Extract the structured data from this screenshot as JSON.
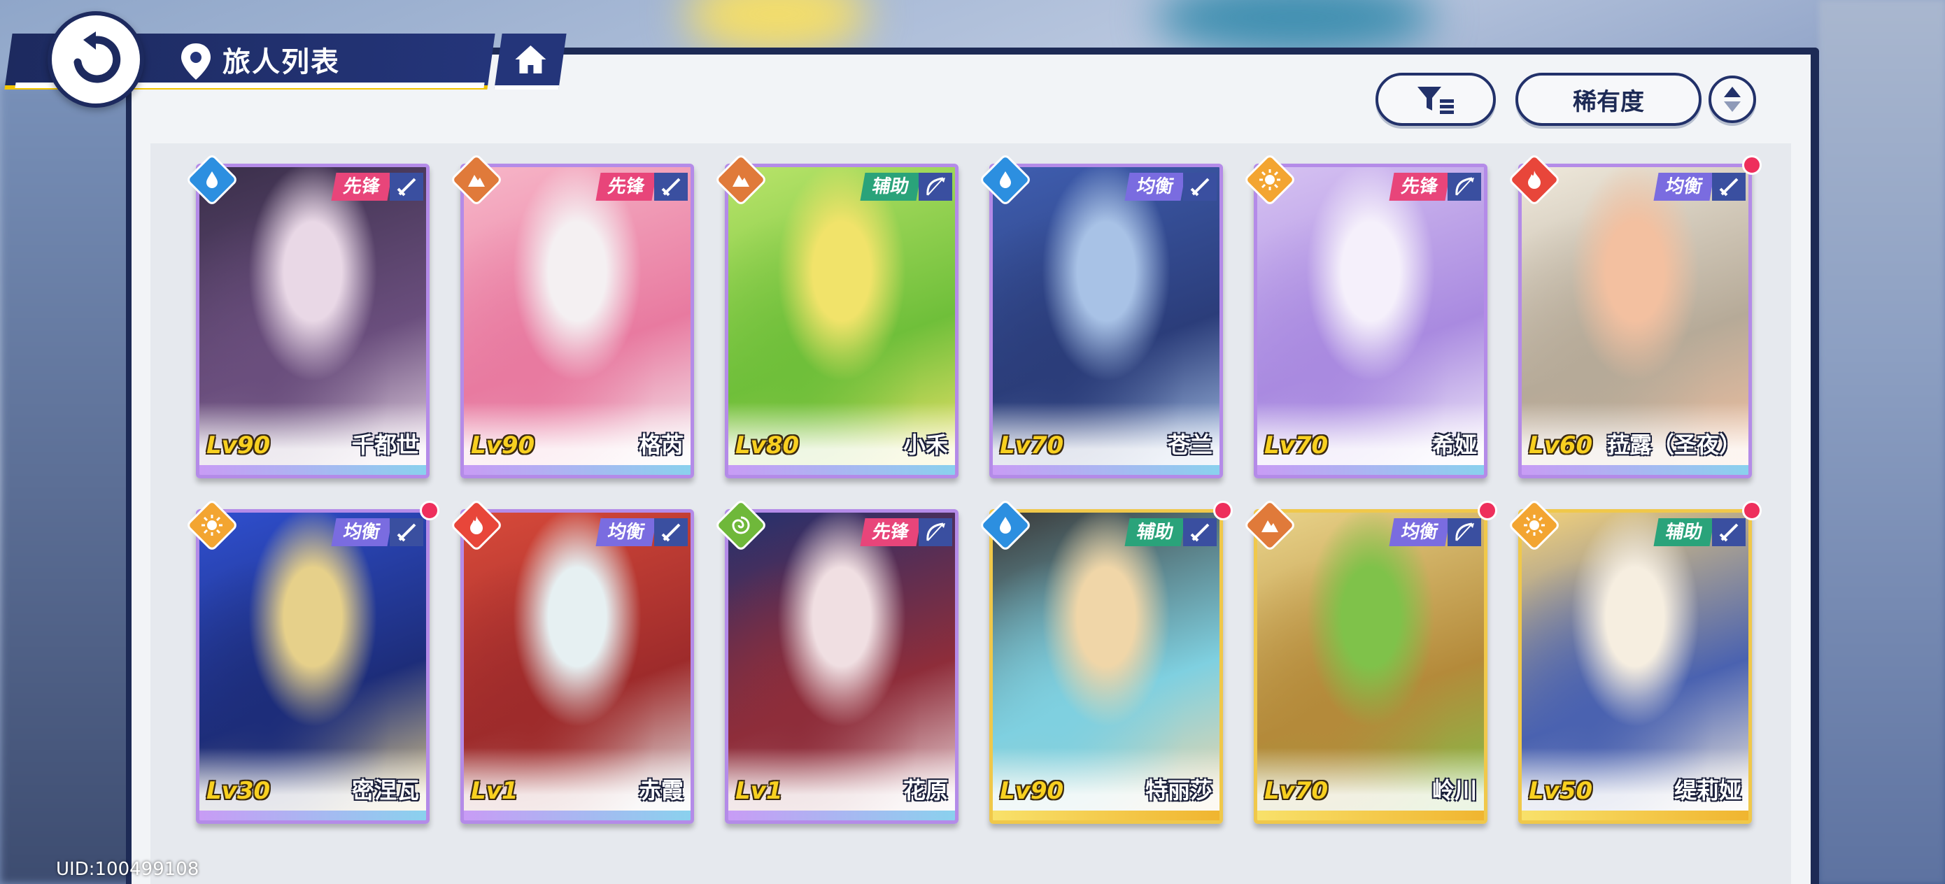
{
  "header": {
    "title": "旅人列表"
  },
  "controls": {
    "sort_label": "稀有度"
  },
  "colors": {
    "panel_border": "#1d2a55",
    "accent_yellow": "#f8d020",
    "role_vanguard": "#e8457a",
    "role_balance": "#7a6ce0",
    "role_support": "#2aa37a",
    "element_water": "#2c8fe0",
    "element_earth": "#e07a3a",
    "element_sun": "#f3a531",
    "element_fire": "#e8463a",
    "element_wind": "#6fb83a",
    "new_dot": "#ee2f5c"
  },
  "characters": [
    {
      "level": "Lv90",
      "name": "千都世",
      "role": "先锋",
      "element": "water-icon",
      "weapon": "sword-icon",
      "frame": "purple",
      "new": false
    },
    {
      "level": "Lv90",
      "name": "格芮",
      "role": "先锋",
      "element": "earth-icon",
      "weapon": "sword-icon",
      "frame": "purple",
      "new": false
    },
    {
      "level": "Lv80",
      "name": "小禾",
      "role": "辅助",
      "element": "earth-icon",
      "weapon": "bow-icon",
      "frame": "purple",
      "new": false
    },
    {
      "level": "Lv70",
      "name": "苍兰",
      "role": "均衡",
      "element": "water-icon",
      "weapon": "sword-icon",
      "frame": "purple",
      "new": false
    },
    {
      "level": "Lv70",
      "name": "希娅",
      "role": "先锋",
      "element": "sun-icon",
      "weapon": "bow-icon",
      "frame": "purple",
      "new": false
    },
    {
      "level": "Lv60",
      "name": "菈露（圣夜）",
      "role": "均衡",
      "element": "fire-icon",
      "weapon": "sword-icon",
      "frame": "purple",
      "new": true
    },
    {
      "level": "Lv30",
      "name": "密涅瓦",
      "role": "均衡",
      "element": "sun-icon",
      "weapon": "sword-icon",
      "frame": "purple",
      "new": true
    },
    {
      "level": "Lv1",
      "name": "赤霞",
      "role": "均衡",
      "element": "fire-icon",
      "weapon": "sword-icon",
      "frame": "purple",
      "new": false
    },
    {
      "level": "Lv1",
      "name": "花原",
      "role": "先锋",
      "element": "wind-icon",
      "weapon": "bow-icon",
      "frame": "purple",
      "new": false
    },
    {
      "level": "Lv90",
      "name": "特丽莎",
      "role": "辅助",
      "element": "water-icon",
      "weapon": "sword-icon",
      "frame": "gold",
      "new": true
    },
    {
      "level": "Lv70",
      "name": "岭川",
      "role": "均衡",
      "element": "earth-icon",
      "weapon": "bow-icon",
      "frame": "gold",
      "new": true
    },
    {
      "level": "Lv50",
      "name": "缇莉娅",
      "role": "辅助",
      "element": "sun-icon",
      "weapon": "sword-icon",
      "frame": "gold",
      "new": true
    }
  ],
  "footer": {
    "uid": "UID:100499108"
  }
}
